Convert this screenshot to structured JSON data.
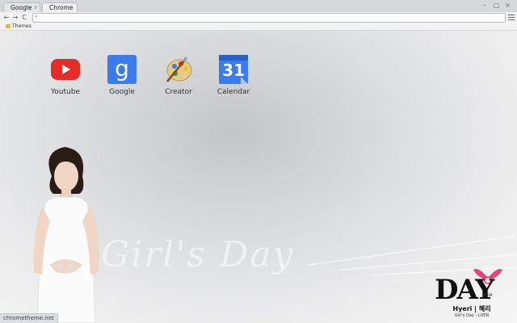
{
  "browser": {
    "tabs": [
      {
        "label": "Google",
        "close_label": "x"
      },
      {
        "label": "Chrome"
      }
    ],
    "window_controls": [
      "–",
      "□",
      "×"
    ],
    "nav": {
      "back": "←",
      "forward": "→",
      "reload": "C"
    },
    "omnibox": {
      "value": "",
      "search_glyph": "⌕"
    },
    "bookmarks": [
      {
        "label": "Themes"
      }
    ]
  },
  "new_tab": {
    "apps": [
      {
        "label": "Youtube",
        "icon": "youtube-icon",
        "color": "#e52d27"
      },
      {
        "label": "Google",
        "icon": "google-icon",
        "glyph": "g",
        "color": "#3b7ced"
      },
      {
        "label": "Creator",
        "icon": "palette-icon"
      },
      {
        "label": "Calendar",
        "icon": "calendar-icon",
        "glyph": "31",
        "color": "#3b7ced"
      }
    ],
    "watermark": "Girl's Day",
    "credit": "chrometheme.net",
    "logo": {
      "main": "DAY",
      "sub": "ASIA",
      "name": "Hyeri  |  혜리",
      "tag": "Girl's Day - LOEN",
      "accent": "#e0467a"
    }
  }
}
